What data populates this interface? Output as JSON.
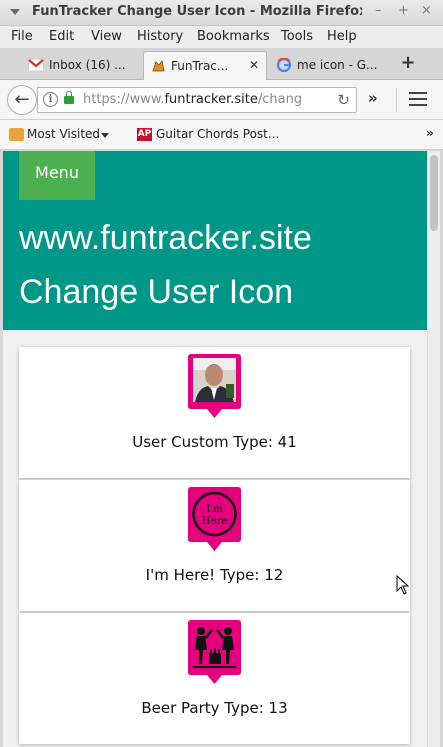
{
  "window": {
    "title": "FunTracker Change User Icon - Mozilla Firefox"
  },
  "menubar": [
    "File",
    "Edit",
    "View",
    "History",
    "Bookmarks",
    "Tools",
    "Help"
  ],
  "tabs": [
    {
      "label": "Inbox (16) ...",
      "icon": "gmail-icon"
    },
    {
      "label": "FunTrac...",
      "icon": "funtracker-icon",
      "active": true
    },
    {
      "label": "me icon - G...",
      "icon": "google-icon"
    }
  ],
  "nav": {
    "url_prefix": "https://www.",
    "url_domain": "funtracker.site",
    "url_rest": "/chang"
  },
  "bookmarks": [
    {
      "label": "Most Visited",
      "icon": "folder-icon"
    },
    {
      "label": "Guitar Chords Post...",
      "icon": "ap-icon"
    }
  ],
  "site": {
    "menu_label": "Menu",
    "title": "www.funtracker.site",
    "subtitle": "Change User Icon"
  },
  "icons": [
    {
      "label": "User Custom Type: 41",
      "kind": "photo"
    },
    {
      "label": "I'm Here! Type: 12",
      "kind": "im-here",
      "badge_text_1": "I'm",
      "badge_text_2": "Here"
    },
    {
      "label": "Beer Party Type: 13",
      "kind": "beer-party"
    }
  ],
  "colors": {
    "header": "#009688",
    "menu_button": "#4caf50",
    "pin": "#e6007e"
  }
}
